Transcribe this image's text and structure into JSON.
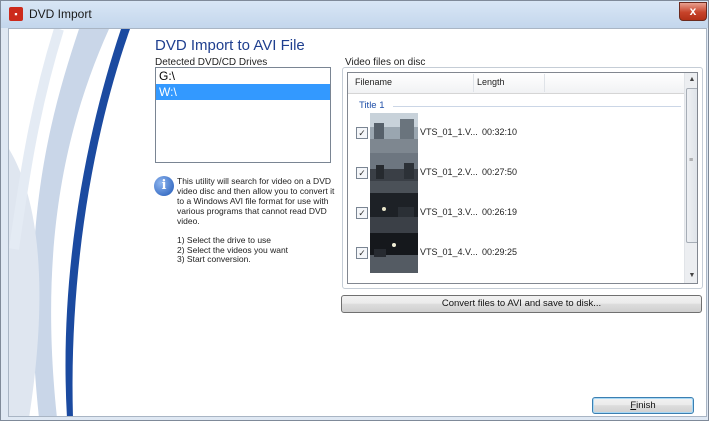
{
  "window": {
    "title": "DVD Import",
    "app_icon": "dvd-import-app-icon",
    "close_glyph": "x"
  },
  "heading": "DVD Import to AVI File",
  "drives": {
    "label": "Detected DVD/CD Drives",
    "items": [
      {
        "label": "G:\\",
        "selected": false
      },
      {
        "label": "W:\\",
        "selected": true
      }
    ]
  },
  "info": {
    "icon": "info-icon",
    "text": "This utility will search for video on a DVD video disc and then allow you to convert it to a Windows AVI file format for use with various programs that cannot read DVD video.",
    "steps": [
      "1) Select the drive to use",
      "2) Select the videos you want",
      "3) Start conversion."
    ]
  },
  "videos": {
    "label": "Video files on disc",
    "columns": {
      "filename": "Filename",
      "length": "Length"
    },
    "group": "Title 1",
    "rows": [
      {
        "checked": true,
        "filename": "VTS_01_1.V...",
        "length": "00:32:10"
      },
      {
        "checked": true,
        "filename": "VTS_01_2.V...",
        "length": "00:27:50"
      },
      {
        "checked": true,
        "filename": "VTS_01_3.V...",
        "length": "00:26:19"
      },
      {
        "checked": true,
        "filename": "VTS_01_4.V...",
        "length": "00:29:25"
      }
    ]
  },
  "buttons": {
    "convert": "Convert files to AVI and save to disk...",
    "finish_f": "F",
    "finish_rest": "inish"
  },
  "colors": {
    "heading": "#1f3f8f",
    "selection": "#3399ff",
    "swoosh": "#1b4aa0"
  }
}
